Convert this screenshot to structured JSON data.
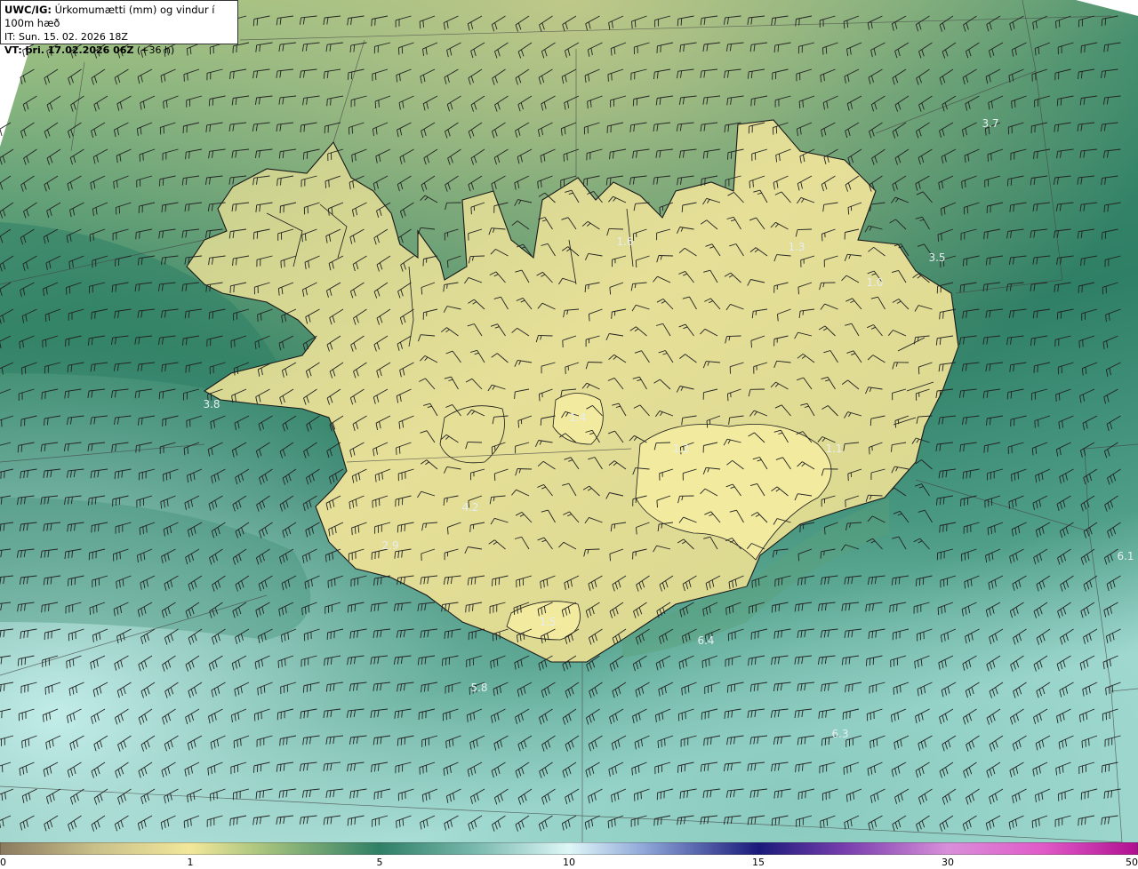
{
  "header": {
    "line1_bold": "UWC/IG:",
    "line1_rest": " Úrkomumætti (mm) og vindur í 100m hæð",
    "line2": "IT: Sun. 15. 02. 2026 18Z",
    "line3_bold": "VT: þri. 17.02.2026 06Z",
    "line3_rest": " (+36 h)"
  },
  "colorbar": {
    "ticks": [
      {
        "label": "0",
        "value": 0
      },
      {
        "label": "1",
        "value": 1
      },
      {
        "label": "5",
        "value": 5
      },
      {
        "label": "10",
        "value": 10
      },
      {
        "label": "15",
        "value": 15
      },
      {
        "label": "30",
        "value": 30
      },
      {
        "label": "50",
        "value": 50
      }
    ],
    "stops": [
      {
        "value": 0,
        "color": "#8a7a5e"
      },
      {
        "value": 0.5,
        "color": "#c9c08a"
      },
      {
        "value": 1,
        "color": "#f2e79a"
      },
      {
        "value": 2.5,
        "color": "#a9c47e"
      },
      {
        "value": 5,
        "color": "#2f7f66"
      },
      {
        "value": 7.5,
        "color": "#78b8ad"
      },
      {
        "value": 10,
        "color": "#dff7f7"
      },
      {
        "value": 12,
        "color": "#8fa6d8"
      },
      {
        "value": 15,
        "color": "#1a1a7a"
      },
      {
        "value": 22,
        "color": "#7a3fae"
      },
      {
        "value": 30,
        "color": "#d98fd9"
      },
      {
        "value": 40,
        "color": "#e05ac8"
      },
      {
        "value": 50,
        "color": "#b01090"
      }
    ]
  },
  "map_labels": [
    {
      "text": "3.7",
      "value": 3.7
    },
    {
      "text": "3.5",
      "value": 3.5
    },
    {
      "text": "3.8",
      "value": 3.8
    },
    {
      "text": "4.2",
      "value": 4.2
    },
    {
      "text": "2.9",
      "value": 2.9
    },
    {
      "text": "6.1",
      "value": 6.1
    },
    {
      "text": "6.4",
      "value": 6.4
    },
    {
      "text": "5.8",
      "value": 5.8
    },
    {
      "text": "6.3",
      "value": 6.3
    },
    {
      "text": "1.6",
      "value": 1.6
    },
    {
      "text": "1.4",
      "value": 1.4
    },
    {
      "text": "1.2",
      "value": 1.2
    },
    {
      "text": "1.3",
      "value": 1.3
    },
    {
      "text": "1.0",
      "value": 1.0
    },
    {
      "text": "1.1",
      "value": 1.1
    },
    {
      "text": "1.5",
      "value": 1.5
    }
  ],
  "colors": {
    "ocean_dark": "#2f7f66",
    "ocean_light": "#8fd2c8",
    "land": "#e9e09a",
    "coast": "#1a1a1a",
    "barb": "#222222"
  }
}
